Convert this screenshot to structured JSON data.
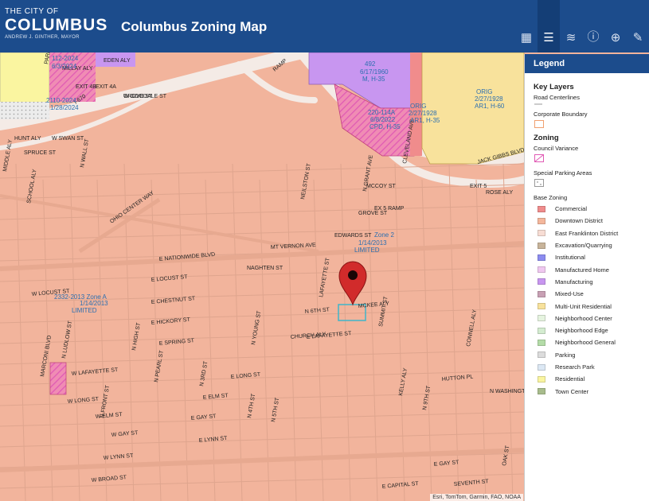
{
  "header": {
    "logo": {
      "line1": "THE CITY OF",
      "line2": "COLUMBUS",
      "line3": "ANDREW J. GINTHER, MAYOR"
    },
    "title": "Columbus Zoning Map",
    "toolbar": [
      {
        "name": "basemap-gallery-icon",
        "glyph": "▦"
      },
      {
        "name": "legend-list-icon",
        "glyph": "☰",
        "active": true
      },
      {
        "name": "layers-icon",
        "glyph": "≋"
      },
      {
        "name": "info-icon",
        "glyph": "ⓘ"
      },
      {
        "name": "share-icon",
        "glyph": "⊕"
      },
      {
        "name": "measure-icon",
        "glyph": "✎"
      }
    ]
  },
  "legend": {
    "title": "Legend",
    "key_layers_title": "Key Layers",
    "key_layers": [
      "Road Centerlines",
      "Corporate Boundary"
    ],
    "zoning_title": "Zoning",
    "zoning_layers": [
      "Council Variance",
      "Special Parking Areas"
    ],
    "base_zoning_title": "Base Zoning",
    "base_zoning": [
      {
        "label": "Commercial",
        "color": "#f08c8c"
      },
      {
        "label": "Downtown District",
        "color": "#f4b79c"
      },
      {
        "label": "East Franklinton District",
        "color": "#f7ddd4"
      },
      {
        "label": "Excavation/Quarrying",
        "color": "#c8b49a"
      },
      {
        "label": "Institutional",
        "color": "#8c8cf0"
      },
      {
        "label": "Manufactured Home",
        "color": "#f0c8f0"
      },
      {
        "label": "Manufacturing",
        "color": "#c896f0"
      },
      {
        "label": "Mixed-Use",
        "color": "#c8a0b4"
      },
      {
        "label": "Multi-Unit Residential",
        "color": "#f8e29c"
      },
      {
        "label": "Neighborhood Center",
        "color": "#e6f4e0"
      },
      {
        "label": "Neighborhood Edge",
        "color": "#d4ecd0"
      },
      {
        "label": "Neighborhood General",
        "color": "#b4dca8"
      },
      {
        "label": "Parking",
        "color": "#dcdcdc"
      },
      {
        "label": "Research Park",
        "color": "#dce8f4"
      },
      {
        "label": "Residential",
        "color": "#faf5a0"
      },
      {
        "label": "Town Center",
        "color": "#a8bc8c"
      }
    ]
  },
  "map": {
    "attribution": "Esri, TomTom, Garmin, FAO, NOAA",
    "colors": {
      "downtown": "#f2b49c",
      "road": "#e0a48c",
      "manufacturing": "#c896f0",
      "commercial": "#f08c8c",
      "multi_unit": "#f8e29c",
      "variance": "#e05ab4"
    },
    "street_labels": [
      "W GOODALE ST",
      "EXIT 4A",
      "EXIT 4B",
      "I-670",
      "PARK ST",
      "EDEN ALY",
      "MILLAY ALY",
      "HUNT ALY",
      "W SWAN ST",
      "SPRUCE ST",
      "N WALL ST",
      "MIDDLE ALY",
      "SCHOOL ALY",
      "OHIO CENTER WAY",
      "E NATIONWIDE BLVD",
      "NAGHTEN ST",
      "MT VERNON AVE",
      "EDWARDS ST",
      "GROVE ST",
      "MCCOY ST",
      "N GRANT AVE",
      "NEILSTON ST",
      "CLEVELAND AVE",
      "EXIT 5",
      "JACK GIBBS BLVD",
      "RAMP",
      "E LOCUST ST",
      "W LOCUST ST",
      "E CHESTNUT ST",
      "E HICKORY ST",
      "E SPRING ST",
      "E LAFAYETTE ST",
      "E LONG ST",
      "E ELM ST",
      "E GAY ST",
      "E LYNN ST",
      "W LAFAYETTE ST",
      "W LONG ST",
      "W ELM ST",
      "W GAY ST",
      "W LYNN ST",
      "W BROAD ST",
      "N LUDLOW ST",
      "MARCONI BLVD",
      "N FRONT ST",
      "N HIGH ST",
      "N PEARL ST",
      "N 3RD ST",
      "N 4TH ST",
      "N YOUNG ST",
      "N 5TH ST",
      "N 6TH ST",
      "MCKEE ALY",
      "CHURCH ALY",
      "LAFAYETTE ST",
      "SUMMIT ST",
      "KELLY ALY",
      "N 9TH ST",
      "CONNELL ALY",
      "N WASHINGTON AVE",
      "HUTTON PL",
      "E GAY ST",
      "E CAPITAL ST",
      "OAK ST",
      "SEVENTH ST",
      "ROSE ALY",
      "EX 5 RAMP",
      "GROVE ST"
    ],
    "zone_labels": [
      "492",
      "6/17/1960",
      "M, H-35",
      "ORIG",
      "2/27/1928",
      "AR1, H-60",
      "220-114A",
      "6/8/2022",
      "CPD, H-35",
      "ORIG",
      "2/27/1928",
      "AR1, H-35",
      "112-2024",
      "6/3/2024",
      "2110-2024",
      "1/28/2024",
      "2332-2013 Zone A",
      "1/14/2013",
      "LIMITED",
      "Zone 2",
      "1/14/2013",
      "LIMITED"
    ],
    "marker_icon": "map-pin-icon"
  }
}
